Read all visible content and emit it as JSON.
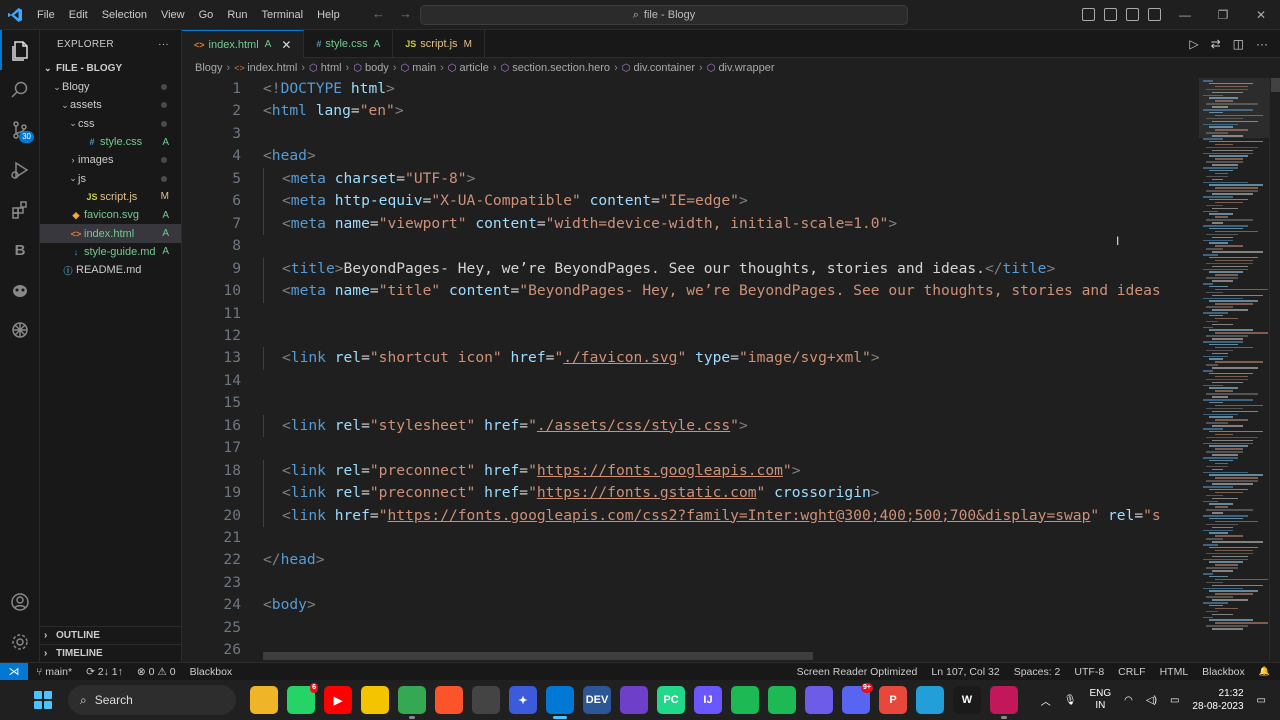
{
  "menu": [
    "File",
    "Edit",
    "Selection",
    "View",
    "Go",
    "Run",
    "Terminal",
    "Help"
  ],
  "command_center": "file - Blogy",
  "explorer": {
    "title": "EXPLORER",
    "root": "FILE - BLOGY",
    "items": [
      {
        "label": "Blogy",
        "indent": 1,
        "chev": "⌄",
        "kind": "folder",
        "status": "",
        "dot": true
      },
      {
        "label": "assets",
        "indent": 2,
        "chev": "⌄",
        "kind": "folder",
        "status": "",
        "dot": true
      },
      {
        "label": "css",
        "indent": 3,
        "chev": "⌄",
        "kind": "folder",
        "status": "",
        "dot": true
      },
      {
        "label": "style.css",
        "indent": 4,
        "chev": "",
        "kind": "css",
        "status": "A",
        "dot": false
      },
      {
        "label": "images",
        "indent": 3,
        "chev": "›",
        "kind": "folder",
        "status": "",
        "dot": true
      },
      {
        "label": "js",
        "indent": 3,
        "chev": "⌄",
        "kind": "folder",
        "status": "",
        "dot": true
      },
      {
        "label": "script.js",
        "indent": 4,
        "chev": "",
        "kind": "js",
        "status": "M",
        "dot": false
      },
      {
        "label": "favicon.svg",
        "indent": 2,
        "chev": "",
        "kind": "svg",
        "status": "A",
        "dot": false
      },
      {
        "label": "index.html",
        "indent": 2,
        "chev": "",
        "kind": "html",
        "status": "A",
        "dot": false
      },
      {
        "label": "style-guide.md",
        "indent": 2,
        "chev": "",
        "kind": "md",
        "status": "A",
        "dot": false
      },
      {
        "label": "README.md",
        "indent": 1,
        "chev": "",
        "kind": "info",
        "status": "",
        "dot": false
      }
    ],
    "outline": "OUTLINE",
    "timeline": "TIMELINE"
  },
  "activity_badge": "30",
  "tabs": [
    {
      "label": "index.html",
      "status": "A",
      "icon": "<>",
      "active": true
    },
    {
      "label": "style.css",
      "status": "A",
      "icon": "#",
      "active": false
    },
    {
      "label": "script.js",
      "status": "M",
      "icon": "JS",
      "active": false
    }
  ],
  "breadcrumb": [
    "Blogy",
    "index.html",
    "html",
    "body",
    "main",
    "article",
    "section.section.hero",
    "div.container",
    "div.wrapper"
  ],
  "code_lines": [
    {
      "n": "1",
      "t": [
        [
          "p",
          "<!"
        ],
        [
          "g",
          "DOCTYPE "
        ],
        [
          "a",
          "html"
        ],
        [
          "p",
          ">"
        ]
      ],
      "i": 0
    },
    {
      "n": "2",
      "t": [
        [
          "p",
          "<"
        ],
        [
          "g",
          "html "
        ],
        [
          "a",
          "lang"
        ],
        [
          "x",
          "="
        ],
        [
          "s",
          "\"en\""
        ],
        [
          "p",
          ">"
        ]
      ],
      "i": 0
    },
    {
      "n": "3",
      "t": [],
      "i": 0
    },
    {
      "n": "4",
      "t": [
        [
          "p",
          "<"
        ],
        [
          "g",
          "head"
        ],
        [
          "p",
          ">"
        ]
      ],
      "i": 0
    },
    {
      "n": "5",
      "t": [
        [
          "p",
          "<"
        ],
        [
          "g",
          "meta "
        ],
        [
          "a",
          "charset"
        ],
        [
          "x",
          "="
        ],
        [
          "s",
          "\"UTF-8\""
        ],
        [
          "p",
          ">"
        ]
      ],
      "i": 1
    },
    {
      "n": "6",
      "t": [
        [
          "p",
          "<"
        ],
        [
          "g",
          "meta "
        ],
        [
          "a",
          "http-equiv"
        ],
        [
          "x",
          "="
        ],
        [
          "s",
          "\"X-UA-Compatible\""
        ],
        [
          "x",
          " "
        ],
        [
          "a",
          "content"
        ],
        [
          "x",
          "="
        ],
        [
          "s",
          "\"IE=edge\""
        ],
        [
          "p",
          ">"
        ]
      ],
      "i": 1
    },
    {
      "n": "7",
      "t": [
        [
          "p",
          "<"
        ],
        [
          "g",
          "meta "
        ],
        [
          "a",
          "name"
        ],
        [
          "x",
          "="
        ],
        [
          "s",
          "\"viewport\""
        ],
        [
          "x",
          " "
        ],
        [
          "a",
          "content"
        ],
        [
          "x",
          "="
        ],
        [
          "s",
          "\"width=device-width, initial-scale=1.0\""
        ],
        [
          "p",
          ">"
        ]
      ],
      "i": 1
    },
    {
      "n": "8",
      "t": [],
      "i": 1
    },
    {
      "n": "9",
      "t": [
        [
          "p",
          "<"
        ],
        [
          "g",
          "title"
        ],
        [
          "p",
          ">"
        ],
        [
          "x",
          "BeyondPages- Hey, we’re BeyondPages. See our thoughts, stories and ideas."
        ],
        [
          "p",
          "</"
        ],
        [
          "g",
          "title"
        ],
        [
          "p",
          ">"
        ]
      ],
      "i": 1
    },
    {
      "n": "10",
      "t": [
        [
          "p",
          "<"
        ],
        [
          "g",
          "meta "
        ],
        [
          "a",
          "name"
        ],
        [
          "x",
          "="
        ],
        [
          "s",
          "\"title\""
        ],
        [
          "x",
          " "
        ],
        [
          "a",
          "content"
        ],
        [
          "x",
          "="
        ],
        [
          "s",
          "\"BeyondPages- Hey, we’re BeyondPages. See our thoughts, stories and ideas"
        ]
      ],
      "i": 1
    },
    {
      "n": "11",
      "t": [],
      "i": 1
    },
    {
      "n": "12",
      "t": [],
      "i": 1
    },
    {
      "n": "13",
      "t": [
        [
          "p",
          "<"
        ],
        [
          "g",
          "link "
        ],
        [
          "a",
          "rel"
        ],
        [
          "x",
          "="
        ],
        [
          "s",
          "\"shortcut icon\""
        ],
        [
          "x",
          " "
        ],
        [
          "a",
          "href"
        ],
        [
          "x",
          "="
        ],
        [
          "s",
          "\""
        ],
        [
          "su",
          "./favicon.svg"
        ],
        [
          "s",
          "\""
        ],
        [
          "x",
          " "
        ],
        [
          "a",
          "type"
        ],
        [
          "x",
          "="
        ],
        [
          "s",
          "\"image/svg+xml\""
        ],
        [
          "p",
          ">"
        ]
      ],
      "i": 1
    },
    {
      "n": "14",
      "t": [],
      "i": 1
    },
    {
      "n": "15",
      "t": [],
      "i": 1
    },
    {
      "n": "16",
      "t": [
        [
          "p",
          "<"
        ],
        [
          "g",
          "link "
        ],
        [
          "a",
          "rel"
        ],
        [
          "x",
          "="
        ],
        [
          "s",
          "\"stylesheet\""
        ],
        [
          "x",
          " "
        ],
        [
          "a",
          "href"
        ],
        [
          "x",
          "="
        ],
        [
          "s",
          "\""
        ],
        [
          "su",
          "./assets/css/style.css"
        ],
        [
          "s",
          "\""
        ],
        [
          "p",
          ">"
        ]
      ],
      "i": 1
    },
    {
      "n": "17",
      "t": [],
      "i": 1
    },
    {
      "n": "18",
      "t": [
        [
          "p",
          "<"
        ],
        [
          "g",
          "link "
        ],
        [
          "a",
          "rel"
        ],
        [
          "x",
          "="
        ],
        [
          "s",
          "\"preconnect\""
        ],
        [
          "x",
          " "
        ],
        [
          "a",
          "href"
        ],
        [
          "x",
          "="
        ],
        [
          "s",
          "\""
        ],
        [
          "su",
          "https://fonts.googleapis.com"
        ],
        [
          "s",
          "\""
        ],
        [
          "p",
          ">"
        ]
      ],
      "i": 1
    },
    {
      "n": "19",
      "t": [
        [
          "p",
          "<"
        ],
        [
          "g",
          "link "
        ],
        [
          "a",
          "rel"
        ],
        [
          "x",
          "="
        ],
        [
          "s",
          "\"preconnect\""
        ],
        [
          "x",
          " "
        ],
        [
          "a",
          "href"
        ],
        [
          "x",
          "="
        ],
        [
          "s",
          "\""
        ],
        [
          "su",
          "https://fonts.gstatic.com"
        ],
        [
          "s",
          "\""
        ],
        [
          "x",
          " "
        ],
        [
          "a",
          "crossorigin"
        ],
        [
          "p",
          ">"
        ]
      ],
      "i": 1
    },
    {
      "n": "20",
      "t": [
        [
          "p",
          "<"
        ],
        [
          "g",
          "link "
        ],
        [
          "a",
          "href"
        ],
        [
          "x",
          "="
        ],
        [
          "s",
          "\""
        ],
        [
          "su",
          "https://fonts.googleapis.com/css2?family=Inter:wght@300;400;500;700&display=swap"
        ],
        [
          "s",
          "\""
        ],
        [
          "x",
          " "
        ],
        [
          "a",
          "rel"
        ],
        [
          "x",
          "="
        ],
        [
          "s",
          "\"s"
        ]
      ],
      "i": 1
    },
    {
      "n": "21",
      "t": [],
      "i": 1
    },
    {
      "n": "22",
      "t": [
        [
          "p",
          "</"
        ],
        [
          "g",
          "head"
        ],
        [
          "p",
          ">"
        ]
      ],
      "i": 0
    },
    {
      "n": "23",
      "t": [],
      "i": 0
    },
    {
      "n": "24",
      "t": [
        [
          "p",
          "<"
        ],
        [
          "g",
          "body"
        ],
        [
          "p",
          ">"
        ]
      ],
      "i": 0
    },
    {
      "n": "25",
      "t": [],
      "i": 1
    },
    {
      "n": "26",
      "t": [],
      "i": 1
    }
  ],
  "status": {
    "branch": "main*",
    "sync": "2↓ 1↑",
    "problems": "⊗ 0 ⚠ 0",
    "left_ext": "Blackbox",
    "right": [
      "Screen Reader Optimized",
      "Ln 107, Col 32",
      "Spaces: 2",
      "UTF-8",
      "CRLF",
      "HTML",
      "Blackbox"
    ]
  },
  "taskbar": {
    "search_placeholder": "Search",
    "apps": [
      {
        "name": "file-explorer-app",
        "label": "",
        "color": "#f0b429",
        "open": false
      },
      {
        "name": "whatsapp-app",
        "label": "",
        "color": "#25d366",
        "open": false,
        "badge": "6"
      },
      {
        "name": "youtube-app",
        "label": "▶",
        "color": "#ff0000",
        "open": false
      },
      {
        "name": "files-app",
        "label": "",
        "color": "#f5c400",
        "open": false
      },
      {
        "name": "chrome-app",
        "label": "",
        "color": "#34a853",
        "open": true
      },
      {
        "name": "brave-app",
        "label": "",
        "color": "#fb542b",
        "open": false
      },
      {
        "name": "chatgpt-app",
        "label": "",
        "color": "#444444",
        "open": false
      },
      {
        "name": "gemini-app",
        "label": "✦",
        "color": "#3b5bdb",
        "open": false
      },
      {
        "name": "vscode-app",
        "label": "",
        "color": "#0078d4",
        "open": true,
        "focus": true
      },
      {
        "name": "devtools-app",
        "label": "DEV",
        "color": "#2b5797",
        "open": false
      },
      {
        "name": "github-app",
        "label": "",
        "color": "#6e40c9",
        "open": false
      },
      {
        "name": "pycharm-app",
        "label": "PC",
        "color": "#21d789",
        "open": false
      },
      {
        "name": "intellij-app",
        "label": "IJ",
        "color": "#6b57ff",
        "open": false
      },
      {
        "name": "loader-app",
        "label": "",
        "color": "#1db954",
        "open": false
      },
      {
        "name": "spotify-app",
        "label": "",
        "color": "#1db954",
        "open": false
      },
      {
        "name": "stream-app",
        "label": "",
        "color": "#6c5ce7",
        "open": false
      },
      {
        "name": "discord-app",
        "label": "",
        "color": "#5865f2",
        "open": false,
        "badge": "9+"
      },
      {
        "name": "pocketcasts-app",
        "label": "P",
        "color": "#e8473c",
        "open": false
      },
      {
        "name": "telegram-app",
        "label": "",
        "color": "#229ed9",
        "open": false
      },
      {
        "name": "wave-app",
        "label": "W",
        "color": "#1a1a1a",
        "open": false
      },
      {
        "name": "terminal-app",
        "label": "",
        "color": "#c2185b",
        "open": true
      }
    ],
    "lang_top": "ENG",
    "lang_bottom": "IN",
    "time": "21:32",
    "date": "28-08-2023"
  },
  "colors": {
    "accent": "#0078d4",
    "added": "#73c991",
    "modified": "#e2c08d"
  }
}
